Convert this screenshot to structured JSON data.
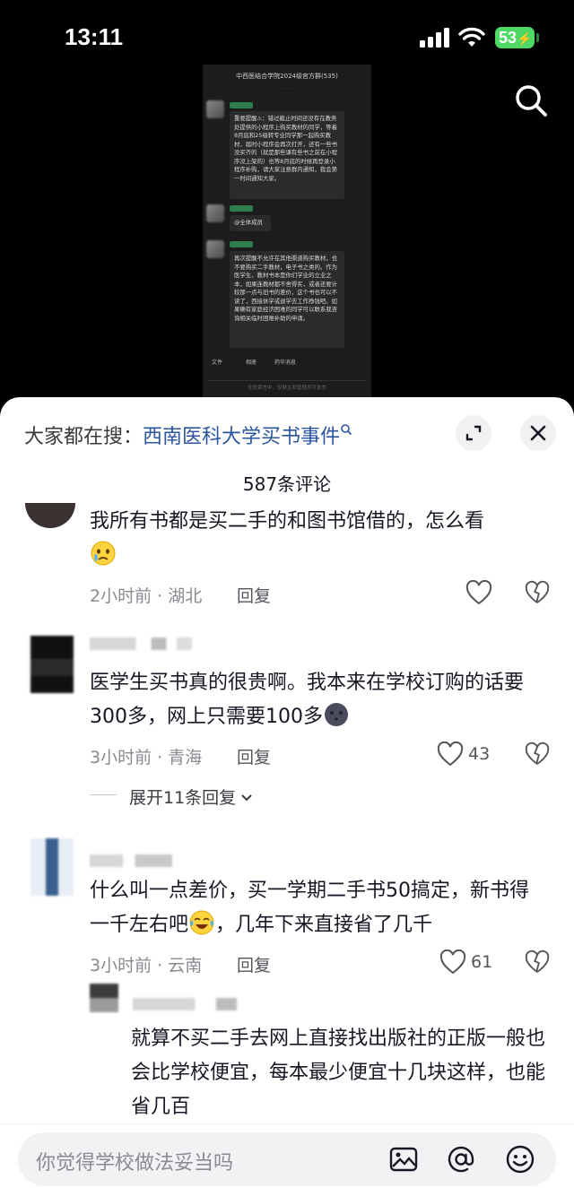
{
  "status_bar": {
    "time": "13:11",
    "battery": "53"
  },
  "screenshot": {
    "title": "中西医结合学院2024级官方群(535)",
    "messages": [
      "重要提醒⚠：错过截止时间还没有在教务处提供的小程序上购买教材的同学，等着8月底和25级转专业同学那一起购买教材，届时小程序会再次打开，还有一些书没买齐的（就是那些课有些书之前在小程序没上架的）也等8月底的时候再登录小程序补购，请大家注意群内通知，我会第一时间通知大家。",
      "@全体成员",
      "再次提醒不允许在其他渠道购买教材，也不要购买二手教材，电子书之类的。作为医学生，教材书本是你们学业的立业之本，如果连教材都不舍得买，或者还要计较那一点与旧书的差价，这个书也可以不读了，西接休学或退学去工作挣钱吧。如果确有家庭经济困难的同学可以联系我咨询相关临时困难补助的申请。"
    ],
    "toolbar": [
      "文件",
      "相册",
      "药华消息"
    ],
    "input_hint": "全员禁言中，仅群主和管理员可发言"
  },
  "sheet": {
    "search_prefix": "大家都在搜：",
    "search_term": "西南医科大学买书事件",
    "comment_count": "587条评论"
  },
  "comments": [
    {
      "text": "我所有书都是买二手的和图书馆借的，怎么看",
      "time": "2小时前 · 湖北",
      "reply": "回复",
      "likes": ""
    },
    {
      "text": "医学生买书真的很贵啊。我本来在学校订购的话要300多，网上只需要100多",
      "time": "3小时前 · 青海",
      "reply": "回复",
      "likes": "43",
      "expand": "展开11条回复"
    },
    {
      "text": "什么叫一点差价，买一学期二手书50搞定，新书得一千左右吧",
      "text_tail": "，几年下来直接省了几千",
      "time": "3小时前 · 云南",
      "reply": "回复",
      "likes": "61"
    },
    {
      "text": "就算不买二手去网上直接找出版社的正版一般也会比学校便宜，每本最少便宜十几块这样，也能省几百"
    }
  ],
  "input": {
    "placeholder": "你觉得学校做法妥当吗"
  }
}
